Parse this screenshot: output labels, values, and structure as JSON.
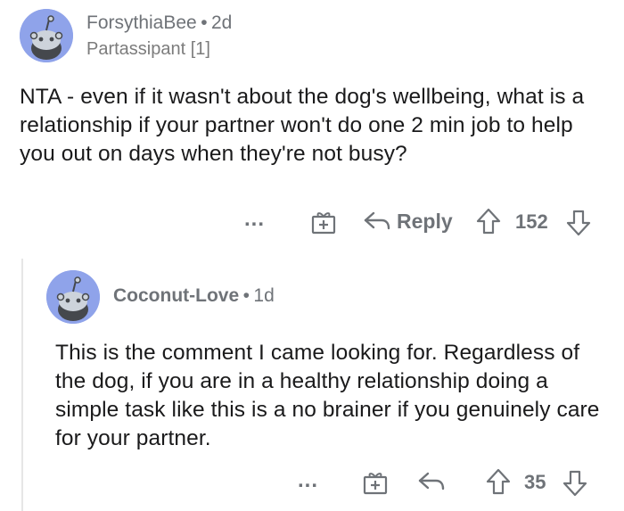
{
  "comments": [
    {
      "username": "ForsythiaBee",
      "separator": "•",
      "age": "2d",
      "flair": "Partassipant [1]",
      "body": "NTA - even if it wasn't about the dog's wellbeing, what is a relationship if your partner won't do one 2 min job to help you out on days when they're not busy?",
      "actions": {
        "more": "...",
        "reply_label": "Reply",
        "score": "152"
      }
    },
    {
      "username": "Coconut-Love",
      "separator": "•",
      "age": "1d",
      "body": "This is the comment I came looking for. Regardless of the dog, if you are in a healthy relationship doing a simple task like this is a no brainer if you genuinely care for your partner.",
      "actions": {
        "more": "...",
        "score": "35"
      }
    }
  ],
  "colors": {
    "avatar_bg": "#8fa3ea",
    "text": "#1a1a1b",
    "muted": "#6f7378"
  },
  "icons": [
    "avatar-icon",
    "gift-icon",
    "reply-arrow-icon",
    "upvote-icon",
    "downvote-icon",
    "more-icon"
  ]
}
